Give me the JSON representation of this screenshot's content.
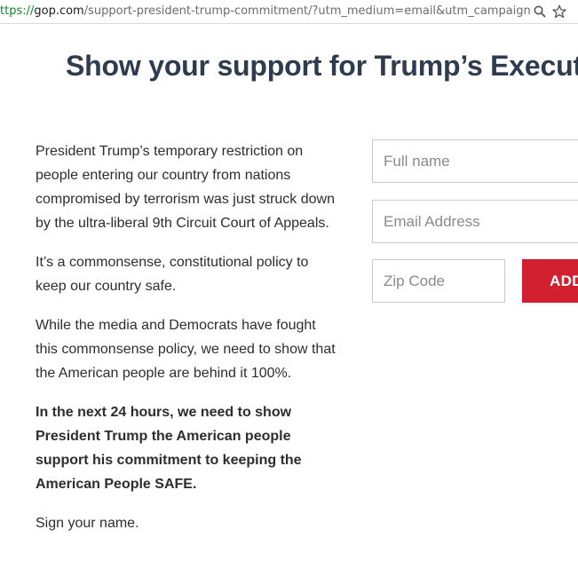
{
  "browser": {
    "url_scheme": "ttps://",
    "url_host": "gop.com",
    "url_rest": "/support-president-trump-commitment/?utm_medium=email&utm_campaign=G",
    "zoom_icon": "magnifier-icon",
    "star_icon": "bookmark-star-icon"
  },
  "page": {
    "headline": "Show your support for Trump’s Executiv"
  },
  "copy": {
    "p1": "President Trump’s temporary restriction on people entering our country from nations compromised by terrorism was just struck down by the ultra-liberal 9th Circuit Court of Appeals.",
    "p2": "It’s a commonsense, constitutional policy to keep our country safe.",
    "p3": "While the media and Democrats have fought this commonsense policy, we need to show that the American people are behind it 100%.",
    "p4": "In the next 24 hours, we need to show President Trump the American people support his commitment to keeping the American People SAFE.",
    "p5": "Sign your name."
  },
  "form": {
    "fullname_placeholder": "Full name",
    "email_placeholder": "Email Address",
    "zip_placeholder": "Zip Code",
    "submit_label": "ADD",
    "accent_color": "#d11f2f"
  }
}
